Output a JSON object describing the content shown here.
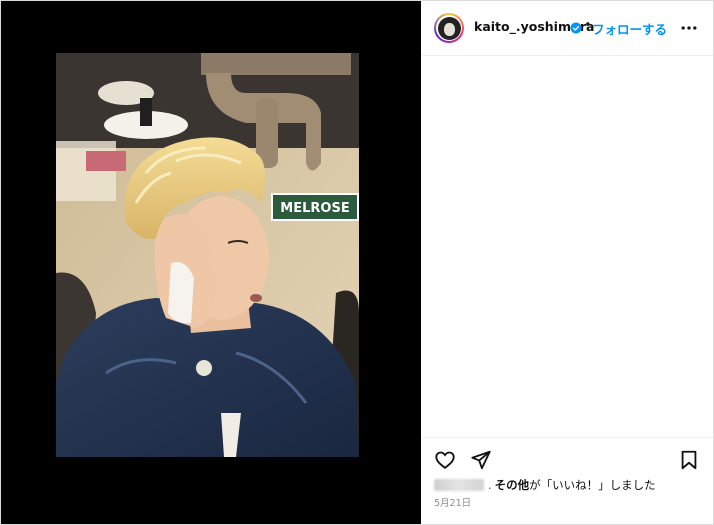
{
  "post": {
    "photo_sign_text": "MELROSE"
  },
  "header": {
    "username": "kaito_.yoshimura",
    "separator": "•",
    "follow_label": "フォローする"
  },
  "likes": {
    "separator": ".",
    "others": "その他",
    "suffix": "が「いいね！」しました"
  },
  "date": "5月21日",
  "colors": {
    "accent": "#0095f6",
    "media_background": "#000000"
  },
  "icons": {
    "like": "heart-icon",
    "share": "send-icon",
    "save": "bookmark-icon",
    "more": "more-options-icon",
    "verified": "verified-badge-icon"
  }
}
